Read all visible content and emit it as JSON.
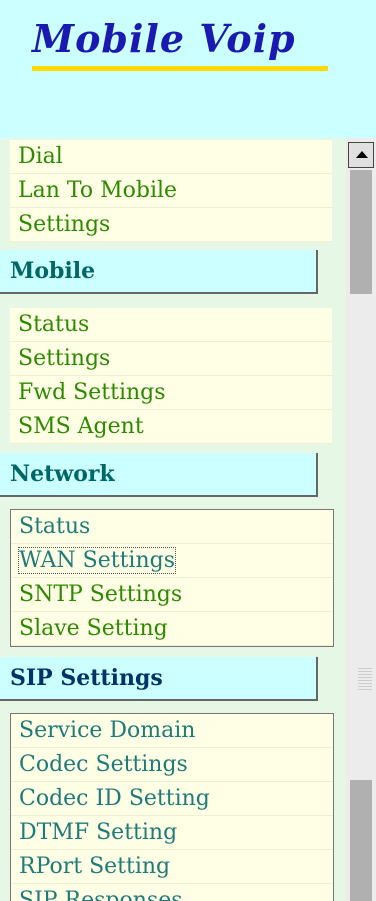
{
  "logo": {
    "text": "Mobile Voip"
  },
  "menu": {
    "top_items": [
      {
        "label": "Dial"
      },
      {
        "label": "Lan To Mobile"
      },
      {
        "label": "Settings"
      }
    ],
    "mobile": {
      "header": "Mobile",
      "items": [
        {
          "label": "Status"
        },
        {
          "label": "Settings"
        },
        {
          "label": "Fwd Settings"
        },
        {
          "label": "SMS Agent"
        }
      ]
    },
    "network": {
      "header": "Network",
      "items": [
        {
          "label": "Status"
        },
        {
          "label": "WAN Settings"
        },
        {
          "label": "SNTP Settings"
        },
        {
          "label": "Slave Setting"
        }
      ]
    },
    "sip": {
      "header": "SIP Settings",
      "items": [
        {
          "label": "Service Domain"
        },
        {
          "label": "Codec Settings"
        },
        {
          "label": "Codec ID Setting"
        },
        {
          "label": "DTMF Setting"
        },
        {
          "label": "RPort Setting"
        },
        {
          "label": "SIP Responses"
        }
      ]
    }
  },
  "colors": {
    "header_bg": "#ccffff",
    "menu_bg": "#e6f7e6",
    "item_bg": "#ffffe6",
    "link_green": "#2d8a00",
    "link_teal": "#1f7a7a",
    "logo_blue": "#1a1ab0",
    "logo_underline": "#ffd800"
  },
  "icons": {
    "scroll_up": "triangle-up-icon"
  }
}
